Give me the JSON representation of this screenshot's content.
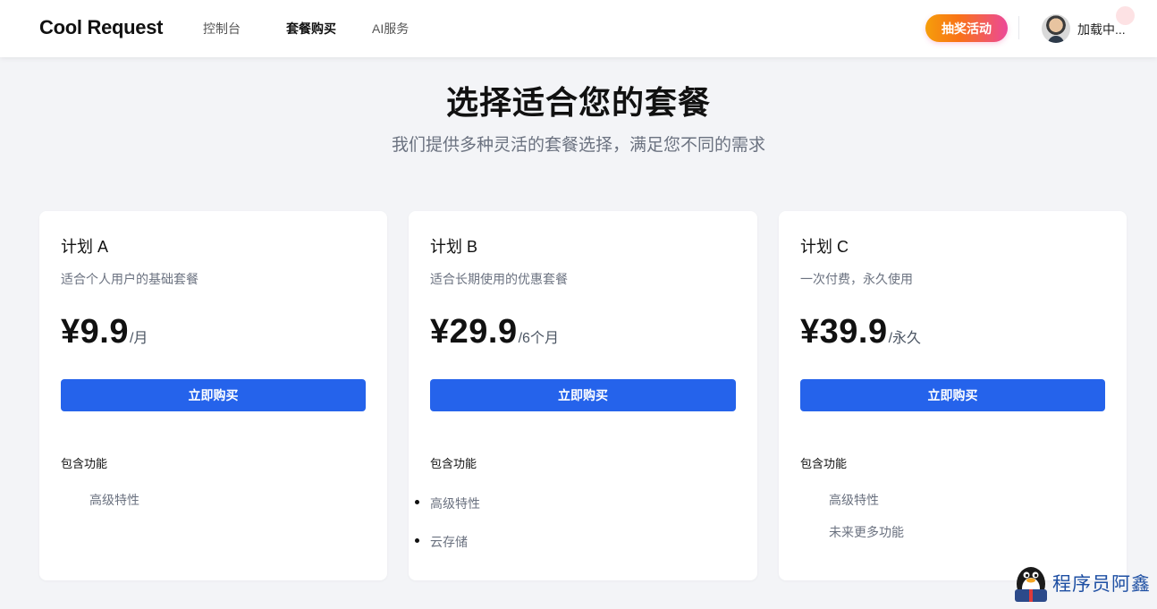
{
  "header": {
    "brand": "Cool Request",
    "nav": [
      {
        "label": "控制台",
        "active": false
      },
      {
        "label": "套餐购买",
        "active": true
      },
      {
        "label": "AI服务",
        "active": false
      }
    ],
    "lottery_label": "抽奖活动",
    "user_name": "加载中..."
  },
  "hero": {
    "title": "选择适合您的套餐",
    "subtitle": "我们提供多种灵活的套餐选择，满足您不同的需求"
  },
  "plans": [
    {
      "name": "计划 A",
      "desc": "适合个人用户的基础套餐",
      "price": "¥9.9",
      "period": "/月",
      "buy_label": "立即购买",
      "features_title": "包含功能",
      "features": [
        "高级特性"
      ]
    },
    {
      "name": "计划 B",
      "desc": "适合长期使用的优惠套餐",
      "price": "¥29.9",
      "period": "/6个月",
      "buy_label": "立即购买",
      "features_title": "包含功能",
      "features": [
        "高级特性",
        "云存储"
      ]
    },
    {
      "name": "计划 C",
      "desc": "一次付费，永久使用",
      "price": "¥39.9",
      "period": "/永久",
      "buy_label": "立即购买",
      "features_title": "包含功能",
      "features": [
        "高级特性",
        "未来更多功能"
      ]
    }
  ],
  "watermark": {
    "text": "程序员阿鑫",
    "icon": "penguin-icon"
  },
  "colors": {
    "primary": "#2563eb",
    "lottery_gradient_start": "#f59e0b",
    "lottery_gradient_end": "#ec4899",
    "watermark_text": "#1e4fa3"
  }
}
